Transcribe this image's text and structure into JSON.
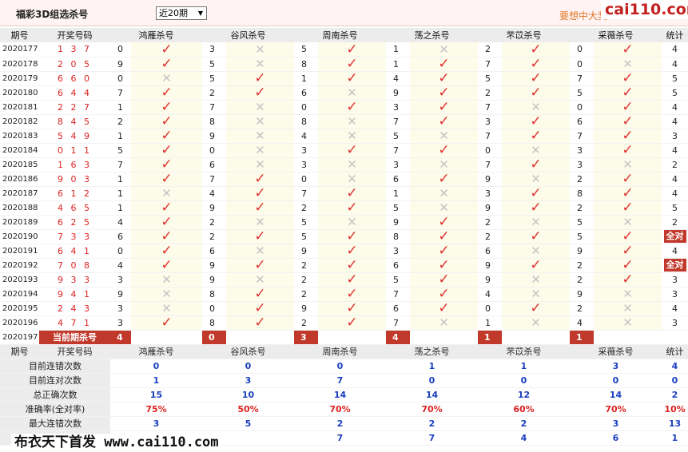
{
  "header": {
    "title": "福彩3D组选杀号",
    "period_select": "近20期",
    "promo": "要想中大奖",
    "watermark_top": "cai110.com"
  },
  "columns": {
    "issue": "期号",
    "draw": "开奖号码",
    "experts": [
      "鸿雁杀号",
      "谷风杀号",
      "周南杀号",
      "荡之杀号",
      "芣苡杀号",
      "采薇杀号"
    ],
    "count": "统计"
  },
  "rows": [
    {
      "issue": "2020177",
      "draw": "1 3 7",
      "picks": [
        [
          "0",
          "ok"
        ],
        [
          "3",
          "x"
        ],
        [
          "5",
          "ok"
        ],
        [
          "1",
          "x"
        ],
        [
          "2",
          "ok"
        ],
        [
          "0",
          "ok"
        ]
      ],
      "count": "4"
    },
    {
      "issue": "2020178",
      "draw": "2 0 5",
      "picks": [
        [
          "9",
          "ok"
        ],
        [
          "5",
          "x"
        ],
        [
          "8",
          "ok"
        ],
        [
          "1",
          "ok"
        ],
        [
          "7",
          "ok"
        ],
        [
          "0",
          "x"
        ]
      ],
      "count": "4"
    },
    {
      "issue": "2020179",
      "draw": "6 6 0",
      "picks": [
        [
          "0",
          "x"
        ],
        [
          "5",
          "ok"
        ],
        [
          "1",
          "ok"
        ],
        [
          "4",
          "ok"
        ],
        [
          "5",
          "ok"
        ],
        [
          "7",
          "ok"
        ]
      ],
      "count": "5"
    },
    {
      "issue": "2020180",
      "draw": "6 4 4",
      "picks": [
        [
          "7",
          "ok"
        ],
        [
          "2",
          "ok"
        ],
        [
          "6",
          "x"
        ],
        [
          "9",
          "ok"
        ],
        [
          "2",
          "ok"
        ],
        [
          "5",
          "ok"
        ]
      ],
      "count": "5"
    },
    {
      "issue": "2020181",
      "draw": "2 2 7",
      "picks": [
        [
          "1",
          "ok"
        ],
        [
          "7",
          "x"
        ],
        [
          "0",
          "ok"
        ],
        [
          "3",
          "ok"
        ],
        [
          "7",
          "x"
        ],
        [
          "0",
          "ok"
        ]
      ],
      "count": "4"
    },
    {
      "issue": "2020182",
      "draw": "8 4 5",
      "picks": [
        [
          "2",
          "ok"
        ],
        [
          "8",
          "x"
        ],
        [
          "8",
          "x"
        ],
        [
          "7",
          "ok"
        ],
        [
          "3",
          "ok"
        ],
        [
          "6",
          "ok"
        ]
      ],
      "count": "4"
    },
    {
      "issue": "2020183",
      "draw": "5 4 9",
      "picks": [
        [
          "1",
          "ok"
        ],
        [
          "9",
          "x"
        ],
        [
          "4",
          "x"
        ],
        [
          "5",
          "x"
        ],
        [
          "7",
          "ok"
        ],
        [
          "7",
          "ok"
        ]
      ],
      "count": "3"
    },
    {
      "issue": "2020184",
      "draw": "0 1 1",
      "picks": [
        [
          "5",
          "ok"
        ],
        [
          "0",
          "x"
        ],
        [
          "3",
          "ok"
        ],
        [
          "7",
          "ok"
        ],
        [
          "0",
          "x"
        ],
        [
          "3",
          "ok"
        ]
      ],
      "count": "4"
    },
    {
      "issue": "2020185",
      "draw": "1 6 3",
      "picks": [
        [
          "7",
          "ok"
        ],
        [
          "6",
          "x"
        ],
        [
          "3",
          "x"
        ],
        [
          "3",
          "x"
        ],
        [
          "7",
          "ok"
        ],
        [
          "3",
          "x"
        ]
      ],
      "count": "2"
    },
    {
      "issue": "2020186",
      "draw": "9 0 3",
      "picks": [
        [
          "1",
          "ok"
        ],
        [
          "7",
          "ok"
        ],
        [
          "0",
          "x"
        ],
        [
          "6",
          "ok"
        ],
        [
          "9",
          "x"
        ],
        [
          "2",
          "ok"
        ]
      ],
      "count": "4"
    },
    {
      "issue": "2020187",
      "draw": "6 1 2",
      "picks": [
        [
          "1",
          "x"
        ],
        [
          "4",
          "ok"
        ],
        [
          "7",
          "ok"
        ],
        [
          "1",
          "x"
        ],
        [
          "3",
          "ok"
        ],
        [
          "8",
          "ok"
        ]
      ],
      "count": "4"
    },
    {
      "issue": "2020188",
      "draw": "4 6 5",
      "picks": [
        [
          "1",
          "ok"
        ],
        [
          "9",
          "ok"
        ],
        [
          "2",
          "ok"
        ],
        [
          "5",
          "x"
        ],
        [
          "9",
          "ok"
        ],
        [
          "2",
          "ok"
        ]
      ],
      "count": "5"
    },
    {
      "issue": "2020189",
      "draw": "6 2 5",
      "picks": [
        [
          "4",
          "ok"
        ],
        [
          "2",
          "x"
        ],
        [
          "5",
          "x"
        ],
        [
          "9",
          "ok"
        ],
        [
          "2",
          "x"
        ],
        [
          "5",
          "x"
        ]
      ],
      "count": "2"
    },
    {
      "issue": "2020190",
      "draw": "7 3 3",
      "picks": [
        [
          "6",
          "ok"
        ],
        [
          "2",
          "ok"
        ],
        [
          "5",
          "ok"
        ],
        [
          "8",
          "ok"
        ],
        [
          "2",
          "ok"
        ],
        [
          "5",
          "ok"
        ]
      ],
      "count": "全对"
    },
    {
      "issue": "2020191",
      "draw": "6 4 1",
      "picks": [
        [
          "0",
          "ok"
        ],
        [
          "6",
          "x"
        ],
        [
          "9",
          "ok"
        ],
        [
          "3",
          "ok"
        ],
        [
          "6",
          "x"
        ],
        [
          "9",
          "ok"
        ]
      ],
      "count": "4"
    },
    {
      "issue": "2020192",
      "draw": "7 0 8",
      "picks": [
        [
          "4",
          "ok"
        ],
        [
          "9",
          "ok"
        ],
        [
          "2",
          "ok"
        ],
        [
          "6",
          "ok"
        ],
        [
          "9",
          "ok"
        ],
        [
          "2",
          "ok"
        ]
      ],
      "count": "全对"
    },
    {
      "issue": "2020193",
      "draw": "9 3 3",
      "picks": [
        [
          "3",
          "x"
        ],
        [
          "9",
          "x"
        ],
        [
          "2",
          "ok"
        ],
        [
          "5",
          "ok"
        ],
        [
          "9",
          "x"
        ],
        [
          "2",
          "ok"
        ]
      ],
      "count": "3"
    },
    {
      "issue": "2020194",
      "draw": "9 4 1",
      "picks": [
        [
          "9",
          "x"
        ],
        [
          "8",
          "ok"
        ],
        [
          "2",
          "ok"
        ],
        [
          "7",
          "ok"
        ],
        [
          "4",
          "x"
        ],
        [
          "9",
          "x"
        ]
      ],
      "count": "3"
    },
    {
      "issue": "2020195",
      "draw": "2 4 3",
      "picks": [
        [
          "3",
          "x"
        ],
        [
          "0",
          "ok"
        ],
        [
          "9",
          "ok"
        ],
        [
          "6",
          "ok"
        ],
        [
          "0",
          "ok"
        ],
        [
          "2",
          "x"
        ]
      ],
      "count": "4"
    },
    {
      "issue": "2020196",
      "draw": "4 7 1",
      "picks": [
        [
          "3",
          "ok"
        ],
        [
          "8",
          "ok"
        ],
        [
          "2",
          "ok"
        ],
        [
          "7",
          "x"
        ],
        [
          "1",
          "x"
        ],
        [
          "4",
          "x"
        ]
      ],
      "count": "3"
    }
  ],
  "current": {
    "issue": "2020197",
    "label": "当前期杀号",
    "picks": [
      "4",
      "0",
      "3",
      "4",
      "1",
      "1"
    ]
  },
  "stats": [
    {
      "label": "目前连错次数",
      "values": [
        "0",
        "0",
        "0",
        "1",
        "1",
        "3"
      ],
      "total": "4"
    },
    {
      "label": "目前连对次数",
      "values": [
        "1",
        "3",
        "7",
        "0",
        "0",
        "0"
      ],
      "total": "0"
    },
    {
      "label": "总正确次数",
      "values": [
        "15",
        "10",
        "14",
        "14",
        "12",
        "14"
      ],
      "total": "2"
    },
    {
      "label": "准确率(全对率)",
      "values": [
        "75%",
        "50%",
        "70%",
        "70%",
        "60%",
        "70%"
      ],
      "total": "10%"
    },
    {
      "label": "最大连错次数",
      "values": [
        "3",
        "5",
        "2",
        "2",
        "2",
        "3"
      ],
      "total": "13"
    },
    {
      "label": "",
      "values": [
        "",
        "",
        "7",
        "7",
        "4",
        "6"
      ],
      "total": "1"
    }
  ],
  "watermark_bottom": "布衣天下首发 www.cai110.com",
  "colors": {
    "check": "#e03030",
    "cross": "#c4c4c4",
    "badge": "#c0392b",
    "stat_blue": "#1a3fbf",
    "stat_red": "#dd2222"
  }
}
